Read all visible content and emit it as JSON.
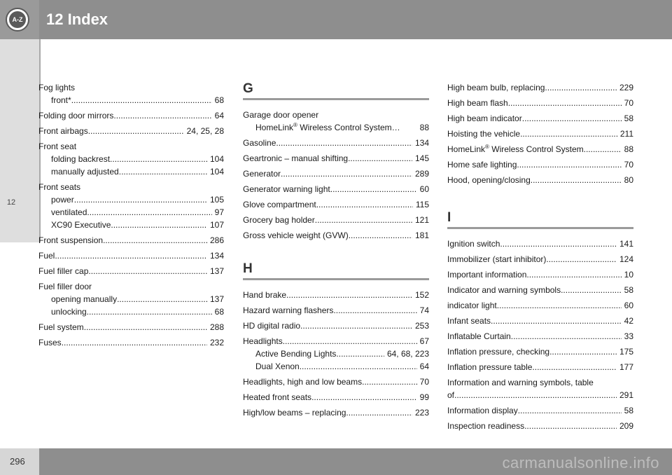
{
  "header": {
    "title": "12 Index",
    "badge": "A-Z"
  },
  "side_tab": {
    "label": "12"
  },
  "footer": {
    "page_number": "296",
    "watermark": "carmanualsonline.info"
  },
  "col1": {
    "fog_lights": "Fog lights",
    "fog_front": {
      "label": "front*",
      "page": "68"
    },
    "folding_mirrors": {
      "label": "Folding door mirrors",
      "page": "64"
    },
    "front_airbags": {
      "label": "Front airbags",
      "page": "24, 25, 28"
    },
    "front_seat": "Front seat",
    "folding_backrest": {
      "label": "folding backrest",
      "page": "104"
    },
    "manually_adjusted": {
      "label": "manually adjusted",
      "page": "104"
    },
    "front_seats": "Front seats",
    "power": {
      "label": "power",
      "page": "105"
    },
    "ventilated": {
      "label": "ventilated",
      "page": "97"
    },
    "xc90": {
      "label": "XC90 Executive",
      "page": "107"
    },
    "front_suspension": {
      "label": "Front suspension",
      "page": "286"
    },
    "fuel": {
      "label": "Fuel",
      "page": "134"
    },
    "fuel_filler_cap": {
      "label": "Fuel filler cap",
      "page": "137"
    },
    "fuel_filler_door": "Fuel filler door",
    "opening_manually": {
      "label": "opening manually",
      "page": "137"
    },
    "unlocking": {
      "label": "unlocking",
      "page": "68"
    },
    "fuel_system": {
      "label": "Fuel system",
      "page": "288"
    },
    "fuses": {
      "label": "Fuses",
      "page": "232"
    }
  },
  "col2": {
    "letter_g": "G",
    "garage_door_opener": "Garage door opener",
    "homelink_a": "HomeLink",
    "homelink_reg": "®",
    "homelink_b": " Wireless Control System…",
    "homelink_page": "88",
    "gasoline": {
      "label": "Gasoline",
      "page": "134"
    },
    "geartronic": {
      "label": "Geartronic – manual shifting",
      "page": "145"
    },
    "generator": {
      "label": "Generator",
      "page": "289"
    },
    "generator_warning": {
      "label": "Generator warning light",
      "page": "60"
    },
    "glove": {
      "label": "Glove compartment",
      "page": "115"
    },
    "grocery": {
      "label": "Grocery bag holder",
      "page": "121"
    },
    "gvw": {
      "label": "Gross vehicle weight (GVW)",
      "page": "181"
    },
    "letter_h": "H",
    "hand_brake": {
      "label": "Hand brake",
      "page": "152"
    },
    "hazard": {
      "label": "Hazard warning flashers",
      "page": "74"
    },
    "hd_radio": {
      "label": "HD digital radio",
      "page": "253"
    },
    "headlights": {
      "label": "Headlights",
      "page": "67"
    },
    "abl": {
      "label": "Active Bending Lights",
      "page": "64, 68, 223"
    },
    "dual_xenon": {
      "label": "Dual Xenon",
      "page": "64"
    },
    "headlights_hl": {
      "label": "Headlights, high and low beams",
      "page": "70"
    },
    "heated_seats": {
      "label": "Heated front seats",
      "page": "99"
    },
    "high_low_replacing": {
      "label": "High/low beams – replacing",
      "page": "223"
    }
  },
  "col3": {
    "hb_bulb": {
      "label": "High beam bulb, replacing",
      "page": "229"
    },
    "hb_flash": {
      "label": "High beam flash",
      "page": "70"
    },
    "hb_indicator": {
      "label": "High beam indicator",
      "page": "58"
    },
    "hoisting": {
      "label": "Hoisting the vehicle",
      "page": "211"
    },
    "homelink_a": "HomeLink",
    "homelink_reg": "®",
    "homelink_b": " Wireless Control System",
    "homelink_page": "88",
    "home_safe": {
      "label": "Home safe lighting",
      "page": "70"
    },
    "hood": {
      "label": "Hood, opening/closing",
      "page": "80"
    },
    "letter_i": "I",
    "ignition": {
      "label": "Ignition switch",
      "page": "141"
    },
    "immobilizer": {
      "label": "Immobilizer (start inhibitor)",
      "page": "124"
    },
    "important": {
      "label": "Important information",
      "page": "10"
    },
    "indicator_symbols": {
      "label": "Indicator and warning symbols",
      "page": "58"
    },
    "indicator_light": {
      "label": "indicator light",
      "page": "60"
    },
    "infant": {
      "label": "Infant seats",
      "page": "42"
    },
    "inflatable": {
      "label": "Inflatable Curtain",
      "page": "33"
    },
    "inflation_check": {
      "label": "Inflation pressure, checking",
      "page": "175"
    },
    "inflation_table": {
      "label": "Inflation pressure table",
      "page": "177"
    },
    "info_symbols_1": "Information and warning symbols, table",
    "info_symbols_2": {
      "label": "of",
      "page": "291"
    },
    "info_display": {
      "label": "Information display",
      "page": "58"
    },
    "inspection": {
      "label": "Inspection readiness",
      "page": "209"
    }
  }
}
